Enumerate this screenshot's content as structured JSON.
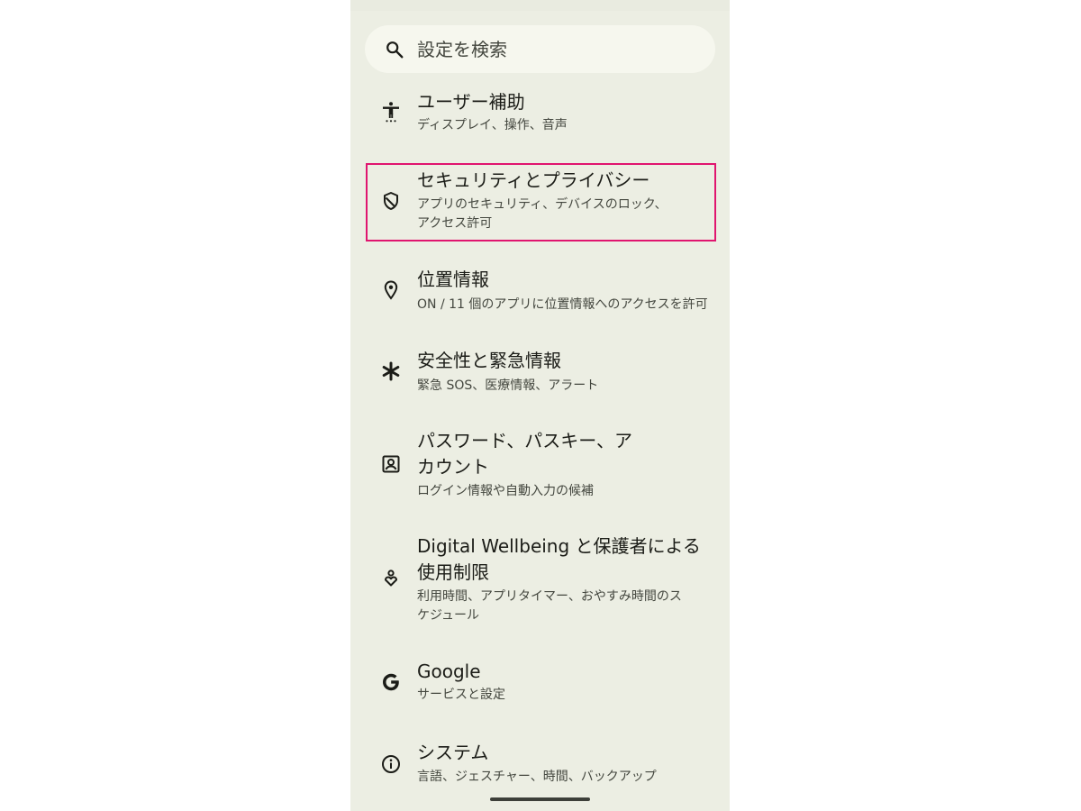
{
  "search": {
    "placeholder": "設定を検索"
  },
  "items": [
    {
      "title": "ユーザー補助",
      "subtitle": "ディスプレイ、操作、音声",
      "icon": "accessibility-icon"
    },
    {
      "title": "セキュリティとプライバシー",
      "subtitle": "アプリのセキュリティ、デバイスのロック、アクセス許可",
      "icon": "shield-icon"
    },
    {
      "title": "位置情報",
      "subtitle": "ON / 11 個のアプリに位置情報へのアクセスを許可",
      "icon": "location-pin-icon"
    },
    {
      "title": "安全性と緊急情報",
      "subtitle": "緊急 SOS、医療情報、アラート",
      "icon": "asterisk-icon"
    },
    {
      "title": "パスワード、パスキー、アカウント",
      "subtitle": "ログイン情報や自動入力の候補",
      "icon": "account-box-icon"
    },
    {
      "title": "Digital Wellbeing と保護者による使用制限",
      "subtitle": "利用時間、アプリタイマー、おやすみ時間のスケジュール",
      "icon": "wellbeing-icon"
    },
    {
      "title": "Google",
      "subtitle": "サービスと設定",
      "icon": "google-g-icon"
    },
    {
      "title": "システム",
      "subtitle": "言語、ジェスチャー、時間、バックアップ",
      "icon": "info-icon"
    }
  ],
  "colors": {
    "background": "#eceee3",
    "search_background": "#f6f7ee",
    "highlight": "#e0156f"
  }
}
